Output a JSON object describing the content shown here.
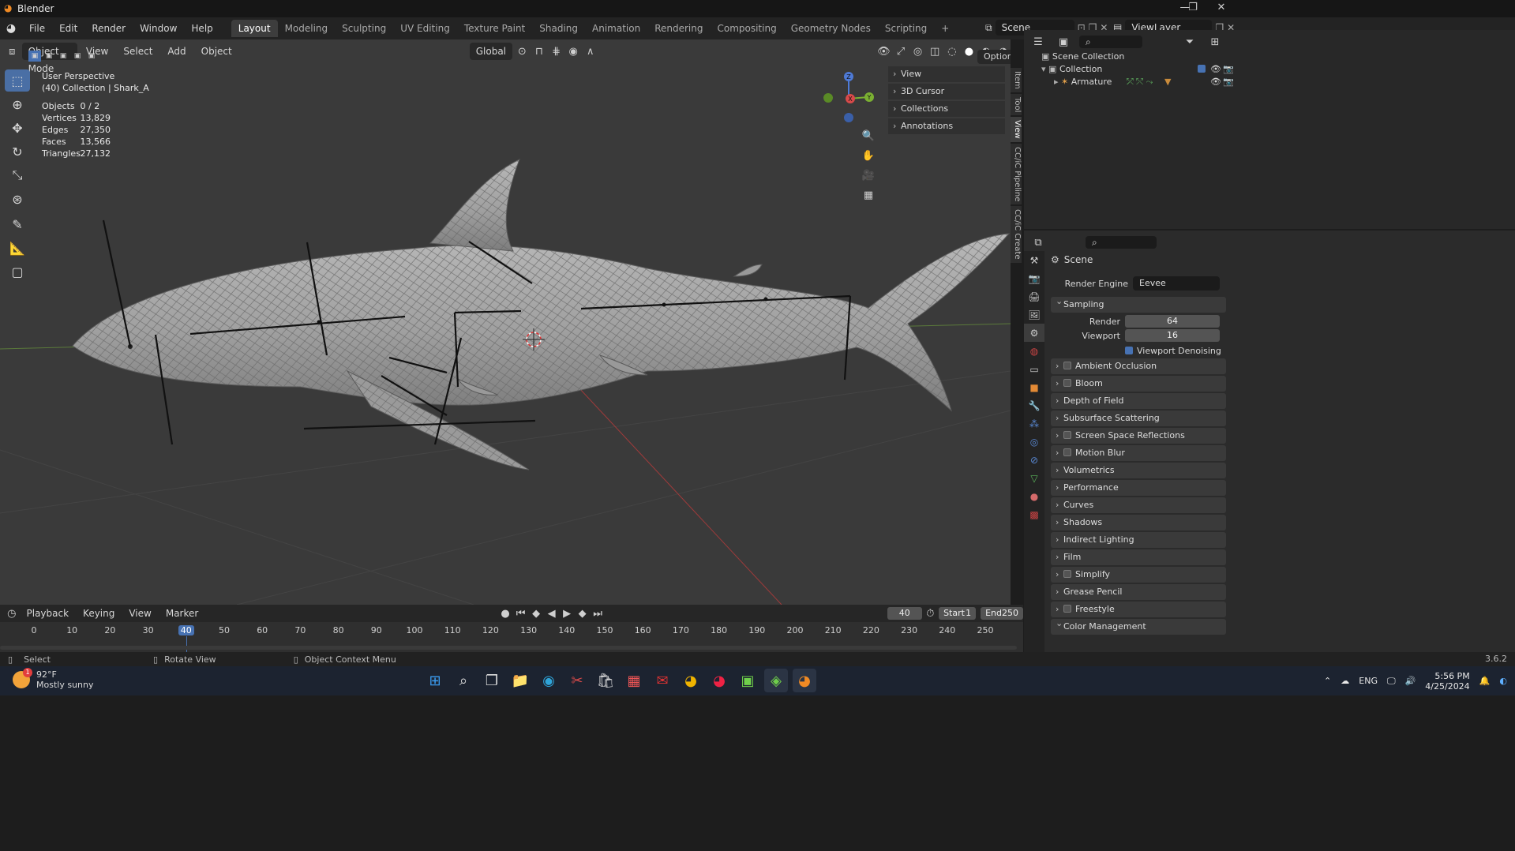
{
  "titlebar": {
    "title": "Blender",
    "minimize": "—",
    "maximize": "❐",
    "close": "✕"
  },
  "menu": [
    "File",
    "Edit",
    "Render",
    "Window",
    "Help"
  ],
  "workspaces": [
    "Layout",
    "Modeling",
    "Sculpting",
    "UV Editing",
    "Texture Paint",
    "Shading",
    "Animation",
    "Rendering",
    "Compositing",
    "Geometry Nodes",
    "Scripting"
  ],
  "workspace_add": "+",
  "scene": {
    "name": "Scene",
    "view_layer": "ViewLayer"
  },
  "viewport_header": {
    "mode": "Object Mode",
    "menus": [
      "View",
      "Select",
      "Add",
      "Object"
    ],
    "orientation": "Global",
    "options_label": "Options"
  },
  "overlay_info": {
    "perspective": "User Perspective",
    "collection": "(40) Collection | Shark_A"
  },
  "stats": [
    {
      "label": "Objects",
      "value": "0 / 2"
    },
    {
      "label": "Vertices",
      "value": "13,829"
    },
    {
      "label": "Edges",
      "value": "27,350"
    },
    {
      "label": "Faces",
      "value": "13,566"
    },
    {
      "label": "Triangles",
      "value": "27,132"
    }
  ],
  "gizmo": {
    "z": "Z",
    "x": "X",
    "y": "Y"
  },
  "n_panel": [
    "View",
    "3D Cursor",
    "Collections",
    "Annotations"
  ],
  "side_tabs": [
    "Item",
    "Tool",
    "View",
    "CC/iC Pipeline",
    "CC/iC Create"
  ],
  "outliner": {
    "root": "Scene Collection",
    "collection": "Collection",
    "armature": "Armature"
  },
  "properties": {
    "context": "Scene",
    "render_engine_label": "Render Engine",
    "render_engine_value": "Eevee",
    "sampling": "Sampling",
    "render_label": "Render",
    "render_value": "64",
    "viewport_label": "Viewport",
    "viewport_value": "16",
    "denoise_label": "Viewport Denoising",
    "panels": [
      {
        "label": "Ambient Occlusion",
        "checkbox": true
      },
      {
        "label": "Bloom",
        "checkbox": true
      },
      {
        "label": "Depth of Field",
        "checkbox": false
      },
      {
        "label": "Subsurface Scattering",
        "checkbox": false
      },
      {
        "label": "Screen Space Reflections",
        "checkbox": true
      },
      {
        "label": "Motion Blur",
        "checkbox": true
      },
      {
        "label": "Volumetrics",
        "checkbox": false
      },
      {
        "label": "Performance",
        "checkbox": false
      },
      {
        "label": "Curves",
        "checkbox": false
      },
      {
        "label": "Shadows",
        "checkbox": false
      },
      {
        "label": "Indirect Lighting",
        "checkbox": false
      },
      {
        "label": "Film",
        "checkbox": false
      },
      {
        "label": "Simplify",
        "checkbox": true
      },
      {
        "label": "Grease Pencil",
        "checkbox": false
      },
      {
        "label": "Freestyle",
        "checkbox": true
      }
    ],
    "color_management": "Color Management"
  },
  "timeline": {
    "menus": [
      "Playback",
      "Keying",
      "View",
      "Marker"
    ],
    "current_frame": "40",
    "start_label": "Start",
    "start_value": "1",
    "end_label": "End",
    "end_value": "250",
    "ticks": [
      "0",
      "10",
      "20",
      "30",
      "40",
      "50",
      "60",
      "70",
      "80",
      "90",
      "100",
      "110",
      "120",
      "130",
      "140",
      "150",
      "160",
      "170",
      "180",
      "190",
      "200",
      "210",
      "220",
      "230",
      "240",
      "250"
    ]
  },
  "statusbar": {
    "select": "Select",
    "rotate": "Rotate View",
    "context_menu": "Object Context Menu",
    "version": "3.6.2"
  },
  "taskbar": {
    "weather_temp": "92°F",
    "weather_desc": "Mostly sunny",
    "lang": "ENG",
    "time": "5:56 PM",
    "date": "4/25/2024",
    "weather_badge": "1"
  }
}
